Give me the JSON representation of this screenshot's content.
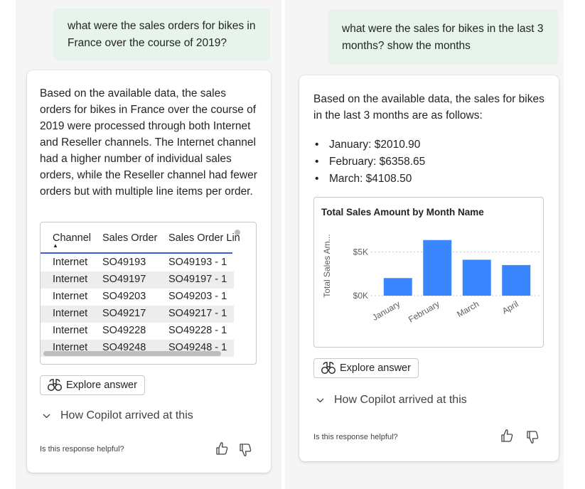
{
  "left": {
    "question": "what were the sales orders for bikes in France over the course of 2019?",
    "answer": "Based on the available data, the sales orders for bikes in France over the course of 2019 were processed through both Internet and Reseller channels. The Internet channel had a higher number of individual sales orders, while the Reseller channel had fewer orders but with multiple line items per order.",
    "table": {
      "headers": [
        "Channel",
        "Sales Order",
        "Sales Order Lin"
      ],
      "rows": [
        [
          "Internet",
          "SO49193",
          "SO49193 - 1"
        ],
        [
          "Internet",
          "SO49197",
          "SO49197 - 1"
        ],
        [
          "Internet",
          "SO49203",
          "SO49203 - 1"
        ],
        [
          "Internet",
          "SO49217",
          "SO49217 - 1"
        ],
        [
          "Internet",
          "SO49228",
          "SO49228 - 1"
        ],
        [
          "Internet",
          "SO49248",
          "SO49248 - 1"
        ]
      ]
    },
    "explore_label": "Explore answer",
    "how_label": "How Copilot arrived at this",
    "helpful_label": "Is this response helpful?"
  },
  "right": {
    "question": "what were the sales for bikes in the last 3 months? show the months",
    "answer": "Based on the available data, the sales for bikes in the last 3 months are as follows:",
    "bullets": [
      "January: $2010.90",
      "February: $6358.65",
      "March: $4108.50"
    ],
    "explore_label": "Explore answer",
    "how_label": "How Copilot arrived at this",
    "helpful_label": "Is this response helpful?"
  },
  "chart_data": {
    "type": "bar",
    "title": "Total Sales Amount by Month Name",
    "xlabel": "",
    "ylabel": "Total Sales Am...",
    "categories": [
      "January",
      "February",
      "March",
      "April"
    ],
    "values": [
      2010.9,
      6358.65,
      4108.5,
      3500
    ],
    "ylim": [
      0,
      6500
    ],
    "yticks": [
      0,
      5000
    ],
    "ytick_labels": [
      "$0K",
      "$5K"
    ],
    "grid": true,
    "bar_color": "#3a86ff"
  },
  "colors": {
    "bubble_bg": "#e6f4ec",
    "accent_underline": "#3b5bdb"
  }
}
